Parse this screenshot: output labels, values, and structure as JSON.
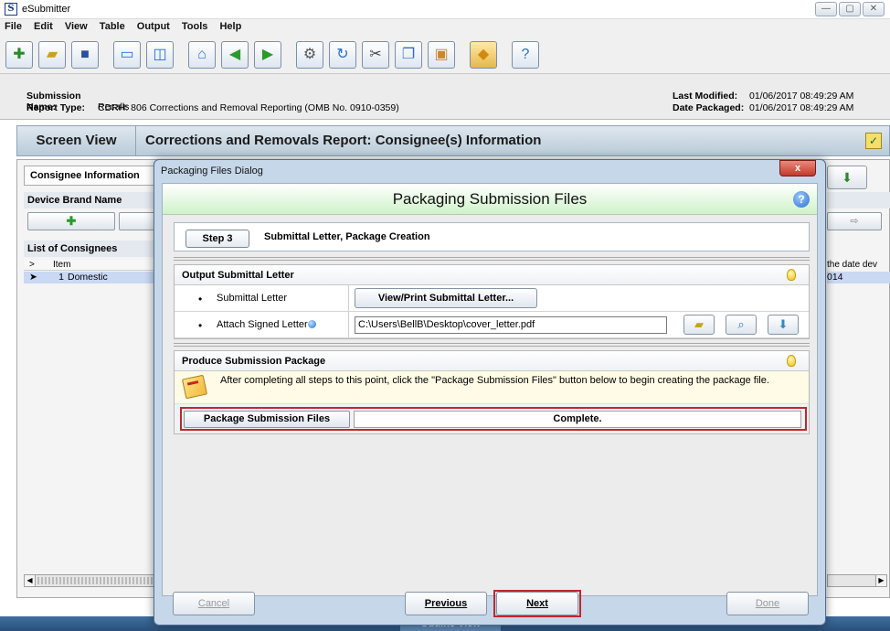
{
  "window": {
    "app_letter": "S",
    "title": "eSubmitter",
    "controls": [
      "—",
      "▢",
      "✕"
    ]
  },
  "menu": [
    "File",
    "Edit",
    "View",
    "Table",
    "Output",
    "Tools",
    "Help"
  ],
  "toolbar_icons": [
    "new-file-icon",
    "open-folder-icon",
    "save-icon",
    "window-icon",
    "split-view-icon",
    "home-icon",
    "back-icon",
    "forward-icon",
    "settings-icon",
    "refresh-icon",
    "cut-icon",
    "copy-icon",
    "paste-icon",
    "package-icon",
    "help-icon"
  ],
  "submission": {
    "name_label": "Submission Name:",
    "name_value": "Recalls",
    "type_label": "Report Type:",
    "type_value": "CDRH: 806 Corrections and Removal Reporting (OMB No. 0910-0359)",
    "modified_label": "Last Modified:",
    "modified_value": "01/06/2017 08:49:29 AM",
    "packaged_label": "Date Packaged:",
    "packaged_value": "01/06/2017 08:49:29 AM"
  },
  "screen": {
    "view_label": "Screen View",
    "report_title": "Corrections and Removals Report: Consignee(s) Information"
  },
  "background": {
    "tab_label": "Consignee Information",
    "brand_label": "Device Brand Name",
    "list_label": "List of Consignees",
    "col_marker": ">",
    "col_item": "Item",
    "row_marker": "➤",
    "row_num": "1",
    "row_text": "Domestic",
    "right_header": "the date dev",
    "right_row": "014"
  },
  "dialog": {
    "title": "Packaging Files Dialog",
    "close": "x",
    "heading": "Packaging Submission Files",
    "step_badge": "Step 3",
    "step_title": "Submittal Letter, Package Creation",
    "output_section": {
      "title": "Output Submittal Letter",
      "row1_label": "Submittal Letter",
      "row1_button": "View/Print Submittal Letter...",
      "row2_label": "Attach Signed Letter",
      "row2_path": "C:\\Users\\BellB\\Desktop\\cover_letter.pdf"
    },
    "produce_section": {
      "title": "Produce Submission Package",
      "note": "After completing all steps to this point, click the \"Package Submission Files\" button below to begin creating the package file.",
      "button": "Package Submission Files",
      "status": "Complete."
    },
    "footer": {
      "cancel": "Cancel",
      "previous": "Previous",
      "next": "Next",
      "done": "Done"
    }
  },
  "bottom": {
    "outline_label": "Outline View"
  },
  "colors": {
    "accent_red": "#c0272d",
    "header_green": "#cff2c9",
    "dialog_frame": "#c6d7ea"
  }
}
